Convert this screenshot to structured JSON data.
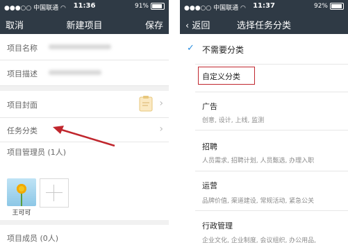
{
  "left": {
    "status": {
      "carrier": "●●●○○ 中国联通 ◠",
      "time": "11:36",
      "battery": "91%"
    },
    "nav": {
      "cancel": "取消",
      "title": "新建项目",
      "save": "保存"
    },
    "fields": [
      {
        "label": "项目名称"
      },
      {
        "label": "项目描述"
      },
      {
        "label": "项目封面"
      },
      {
        "label": "任务分类"
      }
    ],
    "members_manager_label": "项目管理员 (1人)",
    "member_name": "王可可",
    "members_label": "项目成员 (0人)"
  },
  "right": {
    "status": {
      "carrier": "●●●○○ 中国联通 ◠",
      "time": "11:37",
      "battery": "92%"
    },
    "nav": {
      "back": "返回",
      "title": "选择任务分类"
    },
    "none_option": "不需要分类",
    "custom_option": "自定义分类",
    "categories": [
      {
        "name": "广告",
        "desc": "创意, 设计, 上线, 监测"
      },
      {
        "name": "招聘",
        "desc": "人员需求, 招聘计划, 人员甄选, 办理入职"
      },
      {
        "name": "运营",
        "desc": "品牌价值, 渠道建设, 常规活动, 紧急公关"
      },
      {
        "name": "行政管理",
        "desc": "企业文化, 企业制度, 会议组织, 办公用品,"
      }
    ],
    "check_color": "#2a8ee0",
    "highlight_color": "#c0262d"
  }
}
